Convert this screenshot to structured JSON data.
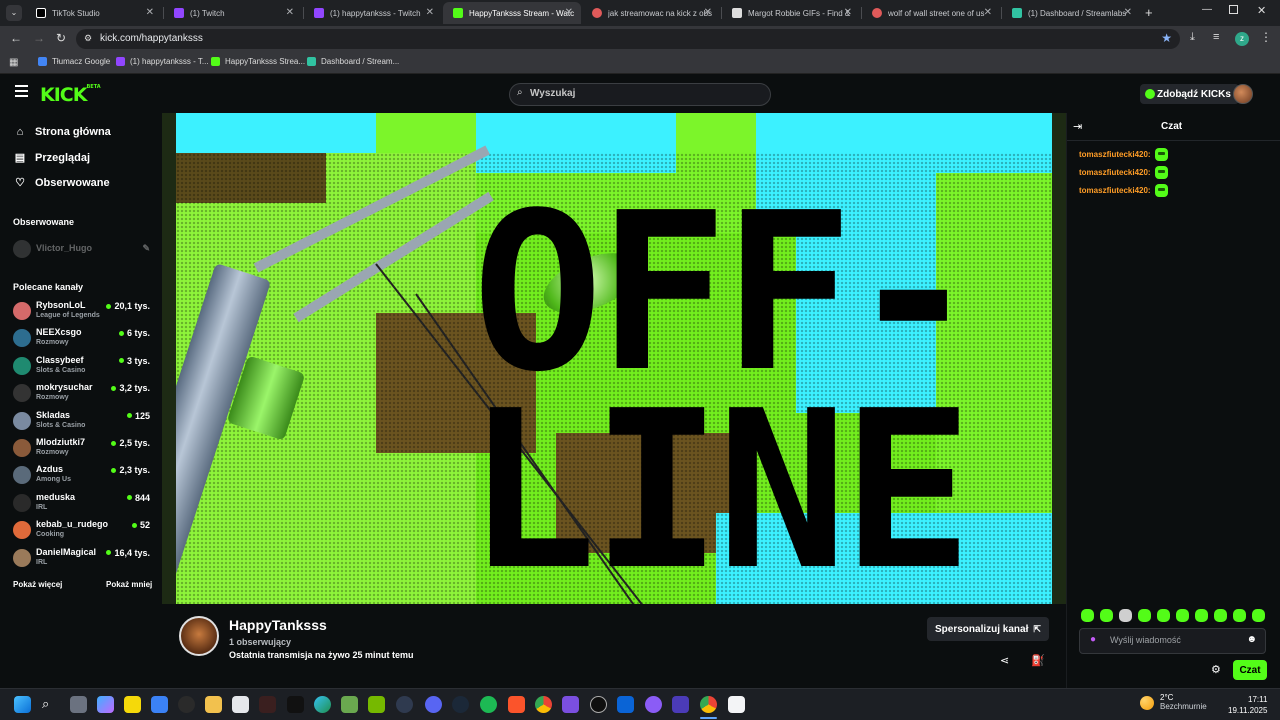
{
  "browser": {
    "tabs": [
      {
        "title": "TikTok Studio",
        "color": "#ffffff"
      },
      {
        "title": "(1) Twitch",
        "color": "#9146ff"
      },
      {
        "title": "(1) happytanksss - Twitch",
        "color": "#9146ff"
      },
      {
        "title": "HappyTanksss Stream - Watc",
        "color": "#53fc18"
      },
      {
        "title": "jak streamowac na kick z obs",
        "color": "#e05a5a"
      },
      {
        "title": "Margot Robbie GIFs - Find &",
        "color": "#dddddd"
      },
      {
        "title": "wolf of wall street one of us",
        "color": "#e05a5a"
      },
      {
        "title": "(1) Dashboard / Streamlabs",
        "color": "#31c3a2"
      }
    ],
    "url": "kick.com/happytanksss",
    "bookmarks": [
      {
        "label": "Tłumacz Google",
        "color": "#4285f4"
      },
      {
        "label": "(1) happytanksss - T...",
        "color": "#9146ff"
      },
      {
        "label": "HappyTanksss Strea...",
        "color": "#53fc18"
      },
      {
        "label": "Dashboard / Stream...",
        "color": "#31c3a2"
      }
    ]
  },
  "header": {
    "logo": "KICK",
    "logo_tag": "BETA",
    "search_placeholder": "Wyszukaj",
    "get_kicks": "Zdobądź KICKs"
  },
  "sidebar": {
    "nav": [
      {
        "label": "Strona główna",
        "icon": "home-icon"
      },
      {
        "label": "Przeglądaj",
        "icon": "browse-icon"
      },
      {
        "label": "Obserwowane",
        "icon": "heart-icon"
      }
    ],
    "followed_title": "Obserwowane",
    "followed": [
      {
        "name": "Vlictor_Hugo"
      }
    ],
    "recommended_title": "Polecane kanały",
    "channels": [
      {
        "name": "RybsonLoL",
        "category": "League of Legends",
        "viewers": "20,1 tys.",
        "color": "#d46a6a"
      },
      {
        "name": "NEEXcsgo",
        "category": "Rozmowy",
        "viewers": "6 tys.",
        "color": "#2d6d8f"
      },
      {
        "name": "Classybeef",
        "category": "Slots & Casino",
        "viewers": "3 tys.",
        "color": "#1f8a70"
      },
      {
        "name": "mokrysuchar",
        "category": "Rozmowy",
        "viewers": "3,2 tys.",
        "color": "#333333"
      },
      {
        "name": "Skladas",
        "category": "Slots & Casino",
        "viewers": "125",
        "color": "#7a8aa0"
      },
      {
        "name": "Mlodziutki7",
        "category": "Rozmowy",
        "viewers": "2,5 tys.",
        "color": "#8a5a3a"
      },
      {
        "name": "Azdus",
        "category": "Among Us",
        "viewers": "2,3 tys.",
        "color": "#5a6a7a"
      },
      {
        "name": "meduska",
        "category": "IRL",
        "viewers": "844",
        "color": "#2a2a2a"
      },
      {
        "name": "kebab_u_rudego",
        "category": "Cooking",
        "viewers": "52",
        "color": "#e06a3a"
      },
      {
        "name": "DanielMagical",
        "category": "IRL",
        "viewers": "16,4 tys.",
        "color": "#9a7a5a"
      }
    ],
    "show_more": "Pokaż więcej",
    "show_less": "Pokaż mniej"
  },
  "player": {
    "line1": "OFF-",
    "line2": "LINE"
  },
  "channel": {
    "name": "HappyTanksss",
    "followers": "1 obserwujący",
    "last_stream": "Ostatnia transmisja na żywo 25 minut temu",
    "personalize": "Spersonalizuj kanał"
  },
  "chat": {
    "title": "Czat",
    "messages": [
      {
        "user": "tomaszfiutecki420:"
      },
      {
        "user": "tomaszfiutecki420:"
      },
      {
        "user": "tomaszfiutecki420:"
      }
    ],
    "input_placeholder": "Wyślij wiadomość",
    "send": "Czat"
  },
  "taskbar": {
    "temperature": "2°C",
    "weather": "Bezchmurnie",
    "time": "17:11",
    "date": "19.11.2025"
  },
  "colors": {
    "accent": "#53fc18",
    "chat_user": "#ff9d27"
  }
}
